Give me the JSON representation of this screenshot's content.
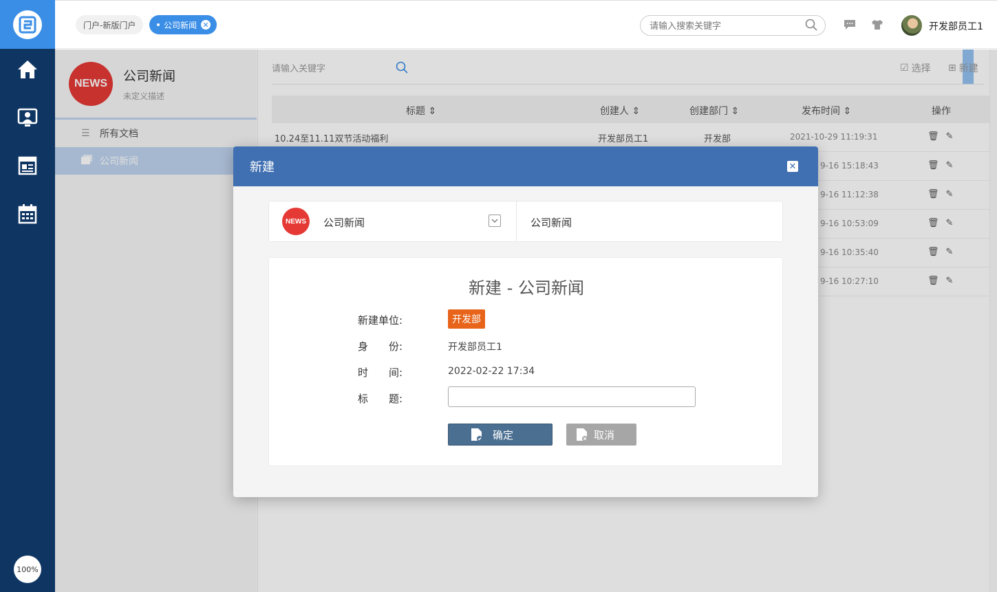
{
  "rail": {
    "zoom": "100%",
    "items": [
      "home-icon",
      "contacts-icon",
      "news-board-icon",
      "calendar-icon"
    ]
  },
  "topbar": {
    "tabs": [
      {
        "label": "门户-新版门户"
      },
      {
        "label": "公司新闻"
      }
    ],
    "search_placeholder": "请输入搜索关键字",
    "user_name": "开发部员工1"
  },
  "sidebar": {
    "logo_text": "NEWS",
    "title": "公司新闻",
    "subtitle": "未定义描述",
    "items": [
      {
        "label": "所有文档"
      },
      {
        "label": "公司新闻"
      }
    ]
  },
  "main": {
    "search_placeholder": "请输入关键字",
    "select_label": "选择",
    "new_label": "新建",
    "columns": [
      "标题",
      "创建人",
      "创建部门",
      "发布时间",
      "操作"
    ],
    "rows": [
      {
        "title": "10.24至11.11双节活动福利",
        "creator": "开发部员工1",
        "dept": "开发部",
        "time": "2021-10-29 11:19:31"
      },
      {
        "title": "",
        "creator": "",
        "dept": "",
        "time": "9-16 15:18:43"
      },
      {
        "title": "",
        "creator": "",
        "dept": "",
        "time": "9-16 11:12:38"
      },
      {
        "title": "",
        "creator": "",
        "dept": "",
        "time": "9-16 10:53:09"
      },
      {
        "title": "",
        "creator": "",
        "dept": "",
        "time": "9-16 10:35:40"
      },
      {
        "title": "",
        "creator": "",
        "dept": "",
        "time": "9-16 10:27:10"
      }
    ]
  },
  "modal": {
    "title": "新建",
    "close_icon": "close-icon",
    "category_logo": "NEWS",
    "category_name": "公司新闻",
    "category_path": "公司新闻",
    "form_title": "新建 - 公司新闻",
    "fields": {
      "unit_label": "新建单位:",
      "unit_value": "开发部",
      "identity_label": "身　　份:",
      "identity_value": "开发部员工1",
      "time_label": "时　　间:",
      "time_value": "2022-02-22 17:34",
      "title_label": "标　　题:",
      "title_value": ""
    },
    "ok_label": "确定",
    "cancel_label": "取消"
  },
  "colors": {
    "rail": "#0f3663",
    "accent": "#3a8ee6",
    "modal_header": "#4070b2",
    "badge": "#e8641a"
  }
}
